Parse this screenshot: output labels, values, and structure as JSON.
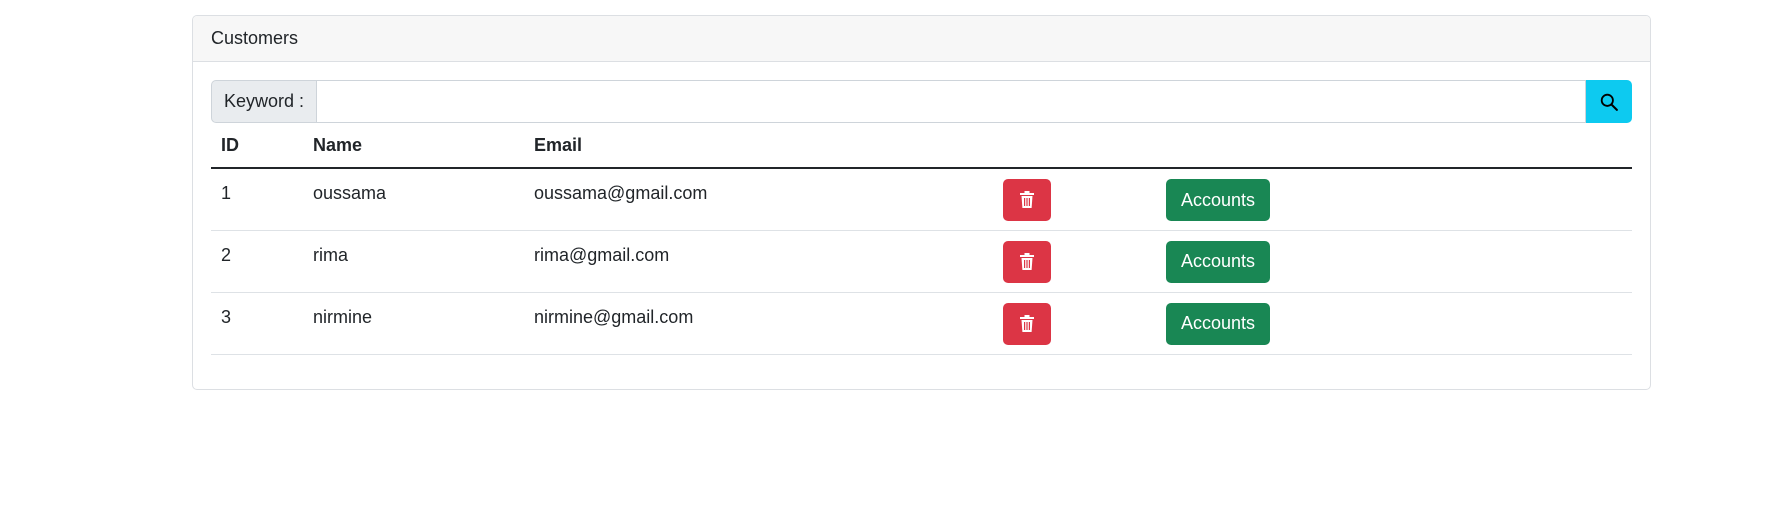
{
  "card": {
    "title": "Customers"
  },
  "search": {
    "label": "Keyword :",
    "value": "",
    "placeholder": "",
    "button_icon": "search-icon"
  },
  "table": {
    "headers": [
      "ID",
      "Name",
      "Email",
      "",
      ""
    ],
    "rows": [
      {
        "id": "1",
        "name": "oussama",
        "email": "oussama@gmail.com",
        "delete_icon": "trash-icon",
        "accounts_label": "Accounts"
      },
      {
        "id": "2",
        "name": "rima",
        "email": "rima@gmail.com",
        "delete_icon": "trash-icon",
        "accounts_label": "Accounts"
      },
      {
        "id": "3",
        "name": "nirmine",
        "email": "nirmine@gmail.com",
        "delete_icon": "trash-icon",
        "accounts_label": "Accounts"
      }
    ]
  },
  "colors": {
    "info": "#0dcaf0",
    "danger": "#dc3545",
    "success": "#198754"
  }
}
